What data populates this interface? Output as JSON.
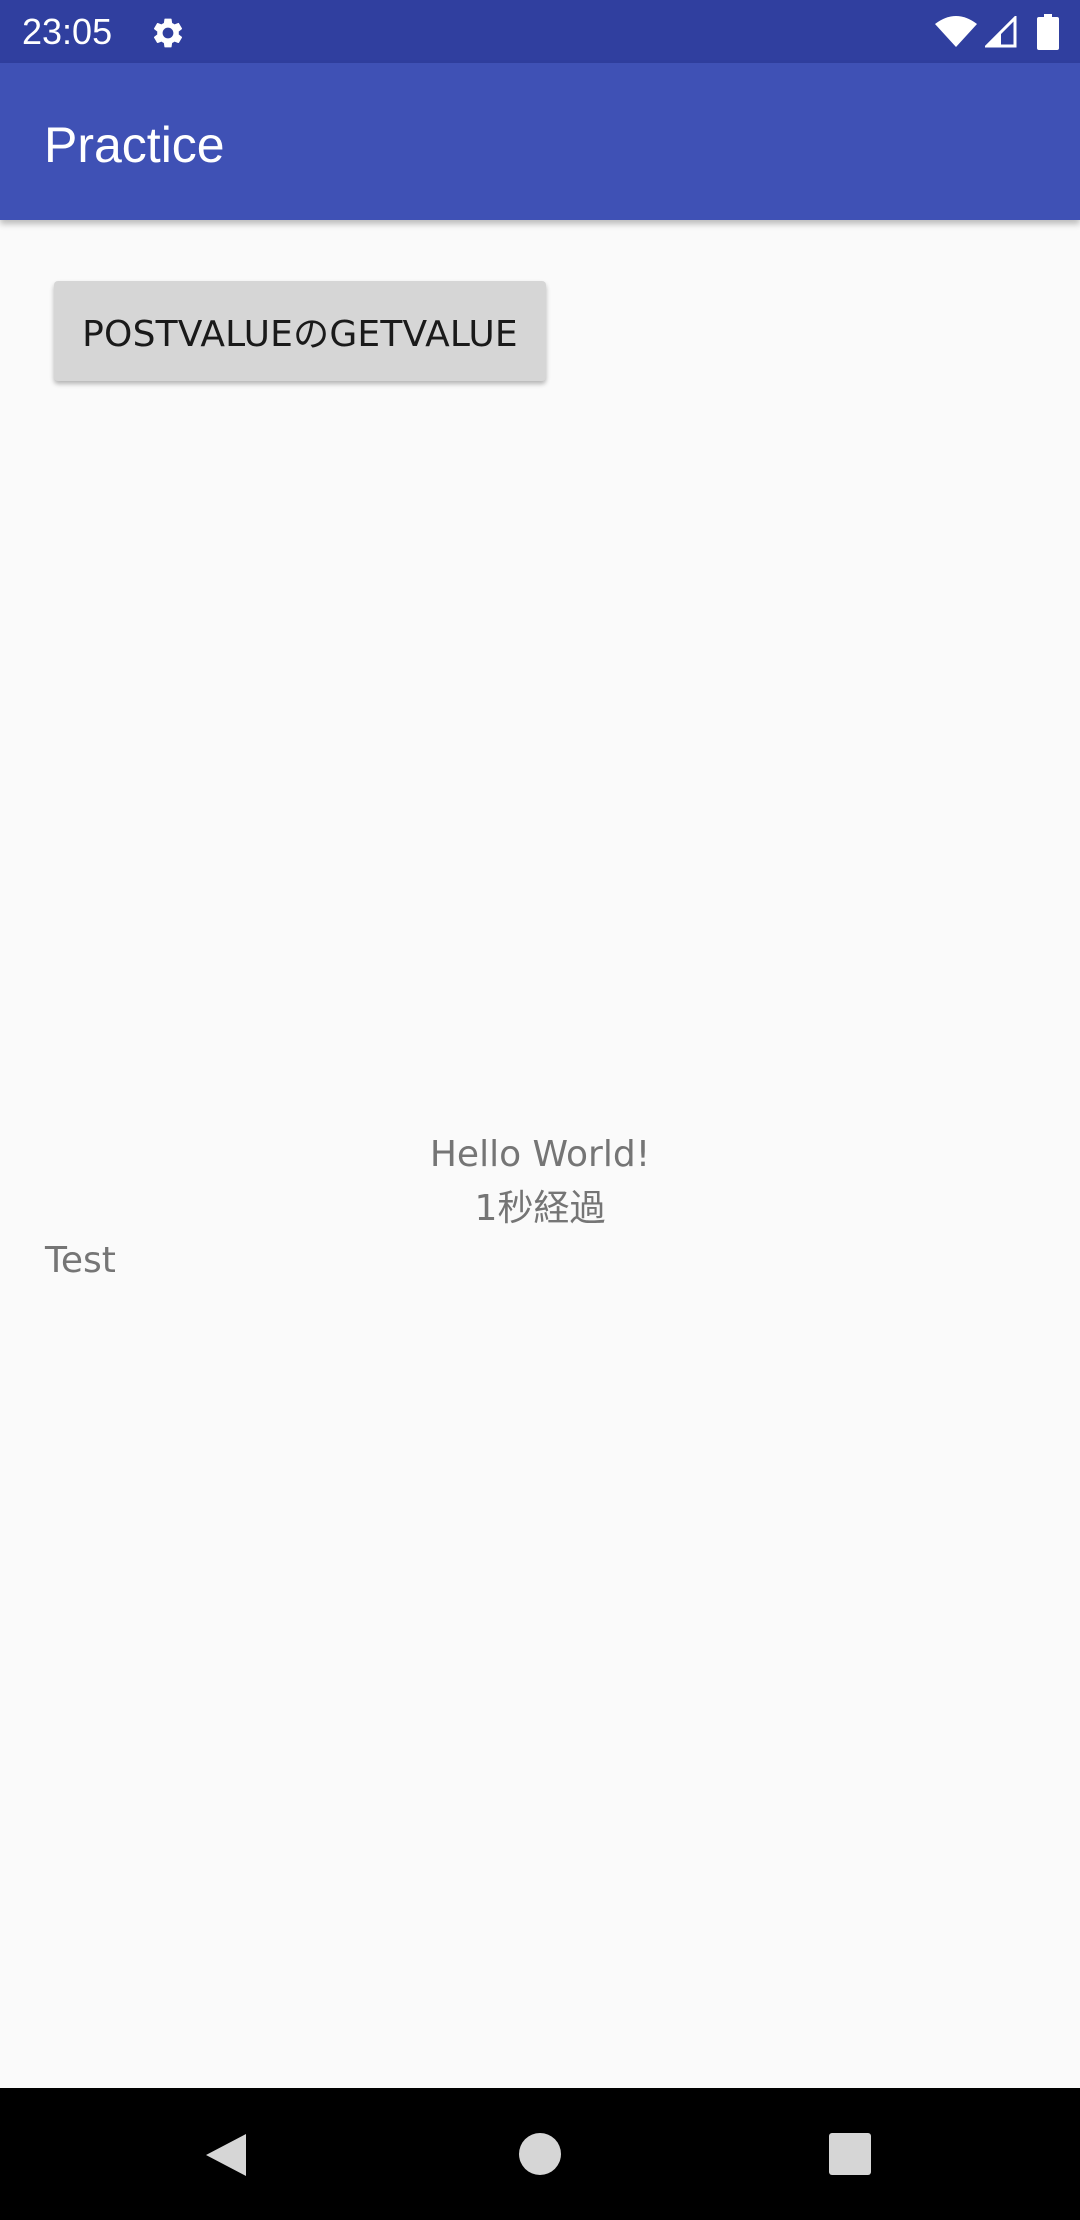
{
  "status_bar": {
    "time": "23:05",
    "icons": [
      "gear-icon",
      "wifi-icon",
      "signal-icon",
      "battery-icon"
    ],
    "background_color": "#303f9f"
  },
  "app_bar": {
    "title": "Practice",
    "background_color": "#3f51b5"
  },
  "main": {
    "button_label": "POSTVALUEのGETVALUE",
    "hello_text": "Hello World!",
    "elapsed_text": "1秒経過",
    "test_text": "Test"
  },
  "nav_bar": {
    "icons": [
      "back-icon",
      "home-icon",
      "recents-icon"
    ]
  }
}
